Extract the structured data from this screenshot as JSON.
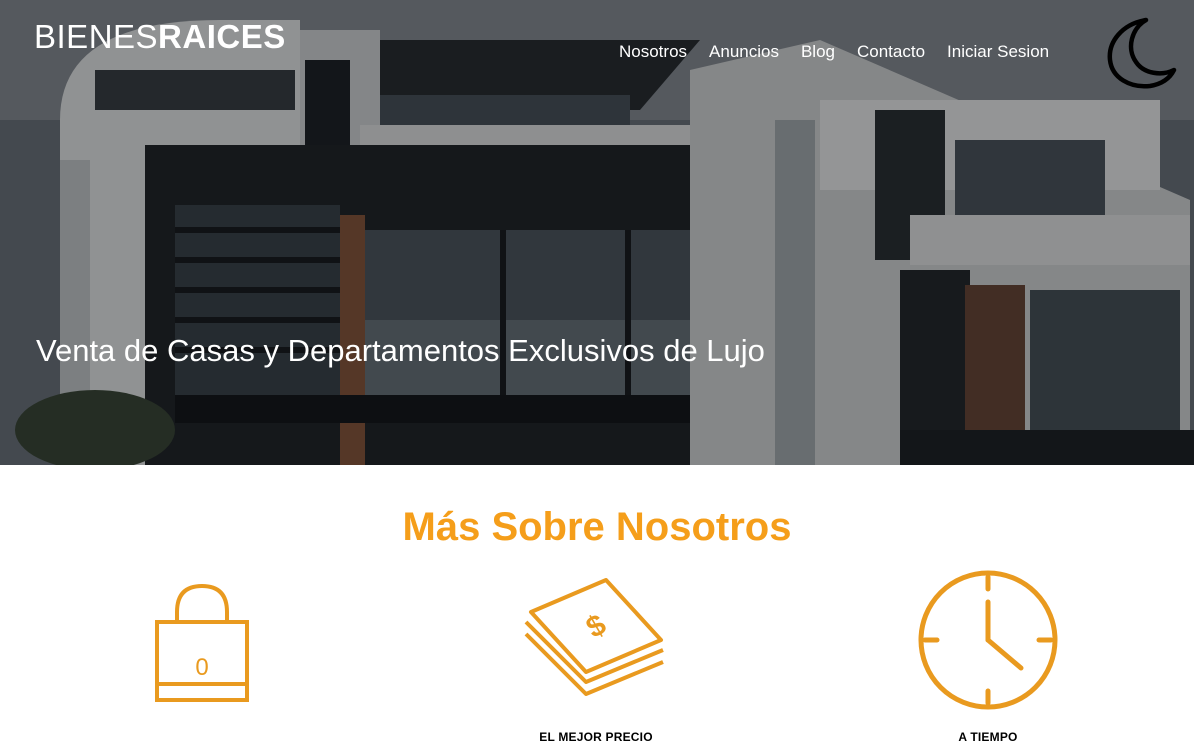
{
  "header": {
    "logo_light": "BIENES",
    "logo_bold": "RAICES",
    "nav": [
      {
        "label": "Nosotros"
      },
      {
        "label": "Anuncios"
      },
      {
        "label": "Blog"
      },
      {
        "label": "Contacto"
      },
      {
        "label": "Iniciar Sesion"
      }
    ],
    "theme_toggle_icon": "moon-icon",
    "hero_title": "Venta de Casas y Departamentos Exclusivos de Lujo"
  },
  "about": {
    "title": "Más Sobre Nosotros",
    "features": [
      {
        "icon": "lock-icon",
        "label": "",
        "lock_digit": "0"
      },
      {
        "icon": "money-icon",
        "label": "EL MEJOR PRECIO"
      },
      {
        "icon": "clock-icon",
        "label": "A TIEMPO"
      }
    ]
  },
  "colors": {
    "accent": "#f59e1a",
    "icon": "#e99a1f",
    "hero_text": "#ffffff"
  }
}
